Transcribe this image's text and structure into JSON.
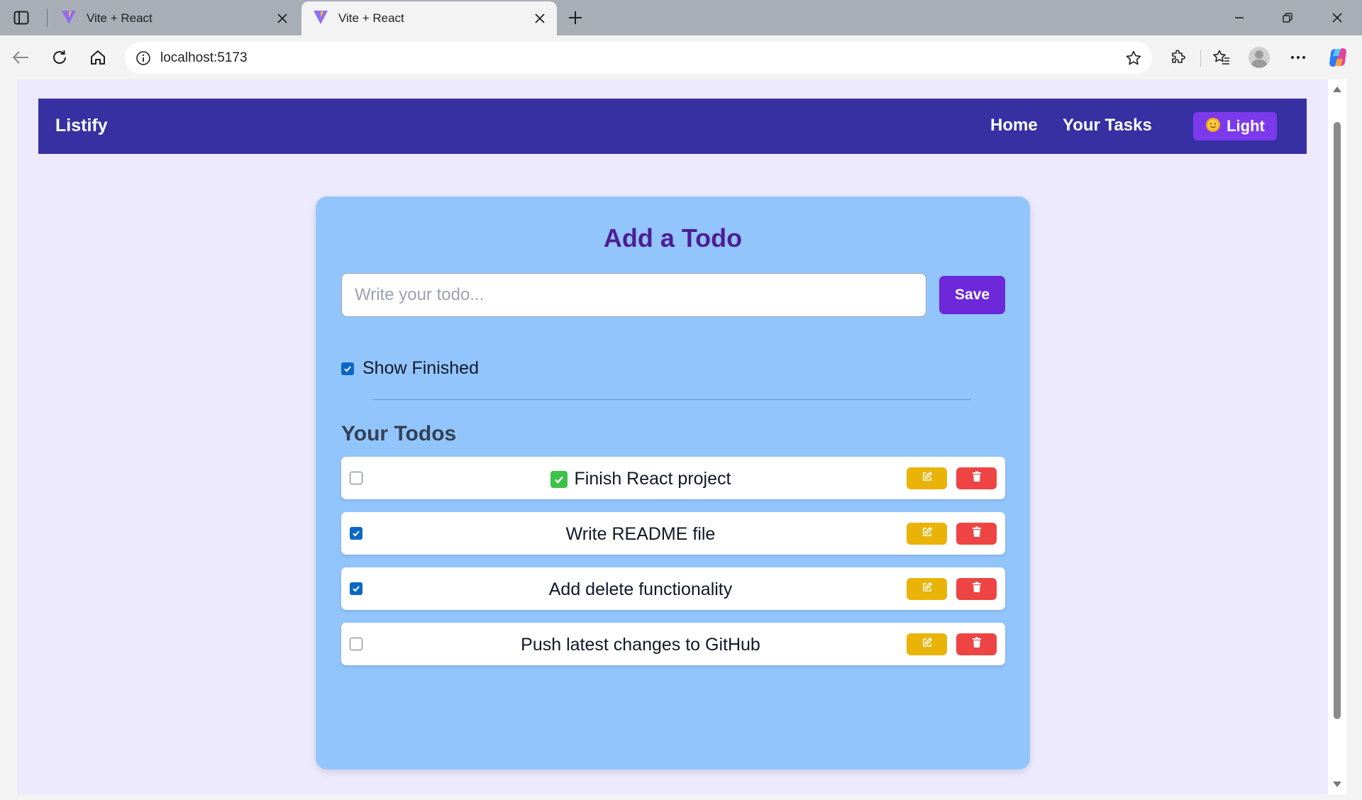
{
  "browser": {
    "tabs": [
      {
        "title": "Vite + React",
        "active": false
      },
      {
        "title": "Vite + React",
        "active": true
      }
    ],
    "url": "localhost:5173",
    "icons": {
      "tab_actions": "tab-actions-icon",
      "favicon": "vite-icon",
      "close_tab": "close-icon",
      "new_tab": "plus-icon",
      "back": "back-arrow-icon",
      "refresh": "refresh-icon",
      "home": "home-icon",
      "site_info": "info-icon",
      "favorite": "star-icon",
      "extensions": "puzzle-icon",
      "favorites": "favorites-icon",
      "profile": "profile-icon",
      "more": "more-icon",
      "copilot": "copilot-icon",
      "minimize": "minimize-icon",
      "restore": "restore-icon",
      "close_window": "close-window-icon"
    }
  },
  "navbar": {
    "brand": "Listify",
    "links": [
      "Home",
      "Your Tasks"
    ],
    "theme_button": {
      "icon": "sun-emoji-icon",
      "label": "Light"
    },
    "background": "#3730a3"
  },
  "form": {
    "title": "Add a Todo",
    "input_placeholder": "Write your todo...",
    "input_value": "",
    "save_label": "Save"
  },
  "filter": {
    "label": "Show Finished",
    "checked": true
  },
  "todos_section": {
    "title": "Your Todos",
    "items": [
      {
        "text": "Finish React project",
        "done": false,
        "emoji": "check-mark-emoji"
      },
      {
        "text": "Write README file",
        "done": true
      },
      {
        "text": "Add delete functionality",
        "done": true
      },
      {
        "text": "Push latest changes to GitHub",
        "done": false
      }
    ],
    "edit_icon": "edit-icon",
    "delete_icon": "trash-icon"
  },
  "colors": {
    "page_background": "#ede9fe",
    "card_background": "#93c5fd",
    "title_color": "#4c1d95",
    "save_button": "#6d28d9",
    "theme_button": "#7c3aed",
    "edit_button": "#eab308",
    "delete_button": "#ef4444"
  }
}
